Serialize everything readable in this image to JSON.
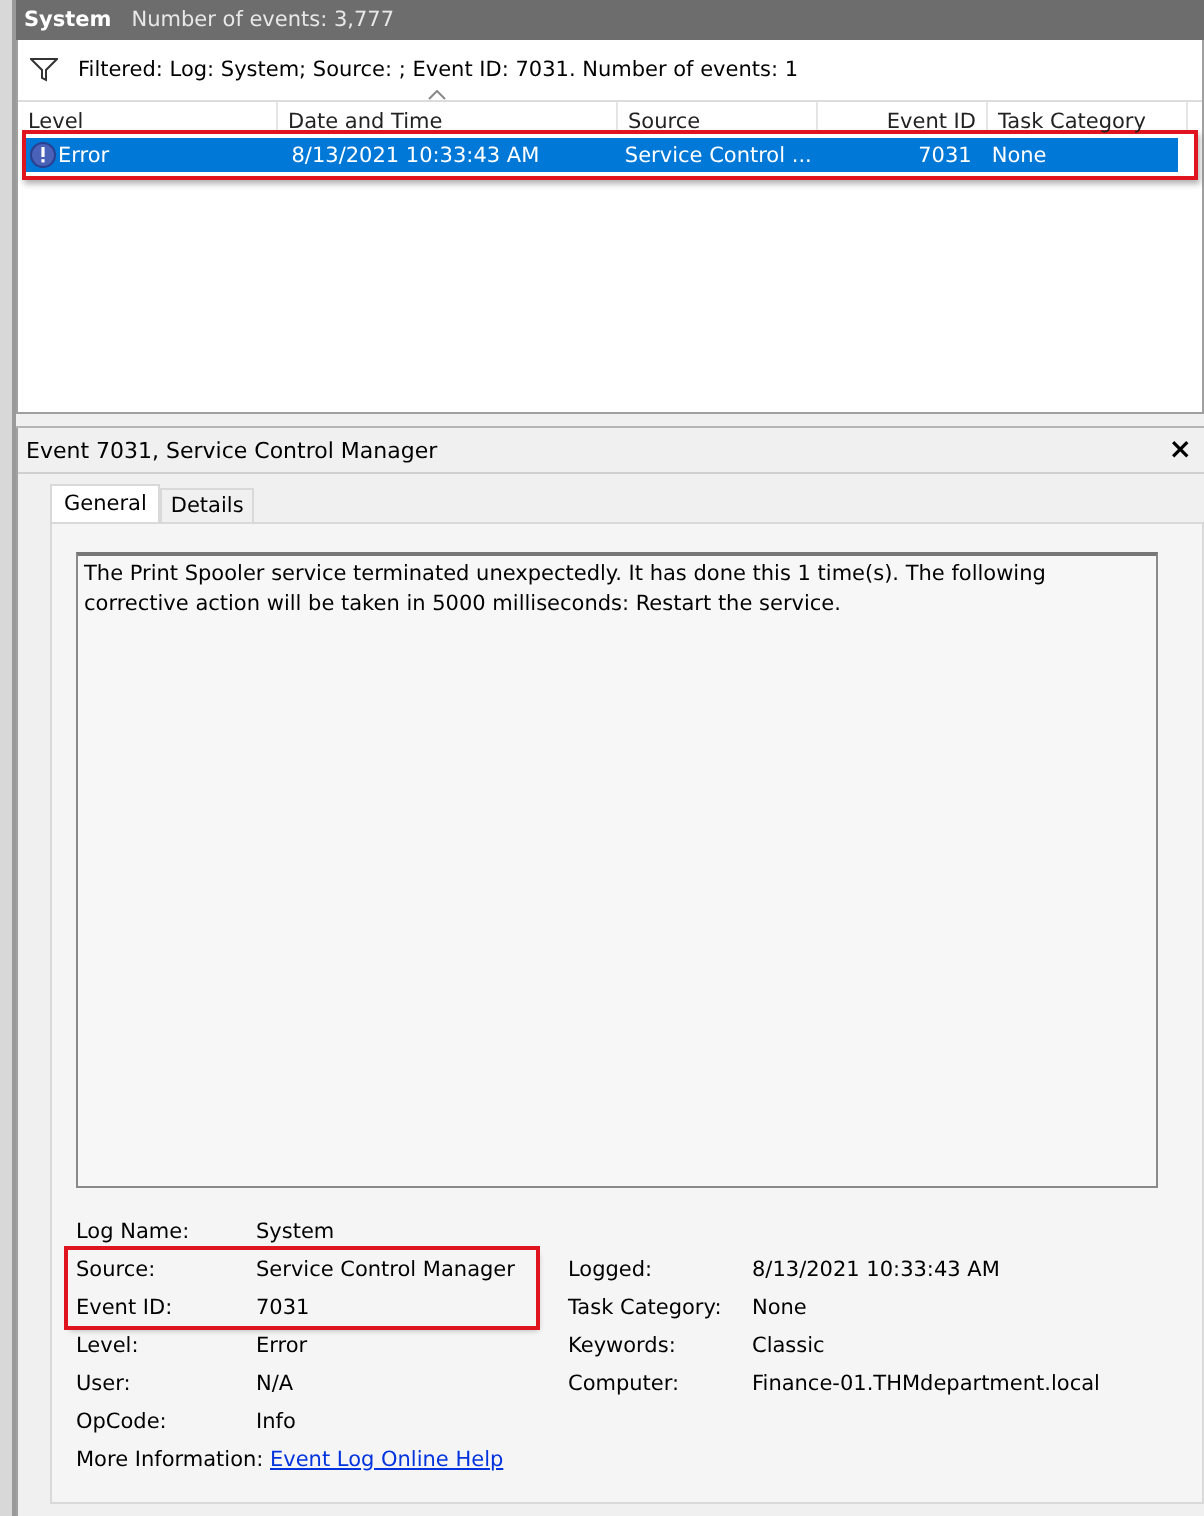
{
  "header": {
    "title": "System",
    "count": "Number of events: 3,777"
  },
  "filter": {
    "text": "Filtered: Log: System; Source: ; Event ID: 7031. Number of events: 1"
  },
  "columns": [
    {
      "label": "Level",
      "sorted": false
    },
    {
      "label": "Date and Time",
      "sorted": true
    },
    {
      "label": "Source",
      "sorted": false
    },
    {
      "label": "Event ID",
      "sorted": false
    },
    {
      "label": "Task Category",
      "sorted": false
    }
  ],
  "events": [
    {
      "selected": true,
      "highlighted": true,
      "cells": [
        "Error",
        "8/13/2021 10:33:43 AM",
        "Service Control ...",
        "7031",
        "None"
      ]
    }
  ],
  "details": {
    "title": "Event 7031, Service Control Manager",
    "close": "×",
    "tabs": [
      {
        "label": "General",
        "selected": true
      },
      {
        "label": "Details",
        "selected": false
      }
    ],
    "message": "The Print Spooler service terminated unexpectedly.  It has done this 1 time(s).  The following corrective action will be taken in 5000 milliseconds: Restart the service.",
    "fields": [
      {
        "label": "Log Name:",
        "value": "System",
        "highlighted": false
      },
      {
        "label": "Source:",
        "value": "Service Control Manager",
        "highlighted": true
      },
      {
        "label": "Event ID:",
        "value": "7031",
        "highlighted": true
      },
      {
        "label": "Level:",
        "value": "Error",
        "highlighted": false
      },
      {
        "label": "User:",
        "value": "N/A",
        "highlighted": false
      },
      {
        "label": "OpCode:",
        "value": "Info",
        "highlighted": false
      }
    ],
    "side_fields": [
      {
        "label": "Logged:",
        "value": "8/13/2021 10:33:43 AM"
      },
      {
        "label": "Task Category:",
        "value": "None"
      },
      {
        "label": "Keywords:",
        "value": "Classic"
      },
      {
        "label": "Computer:",
        "value": "Finance-01.THMdepartment.local"
      }
    ],
    "more_info": {
      "label": "More Information:",
      "link": "Event Log Online Help"
    }
  }
}
